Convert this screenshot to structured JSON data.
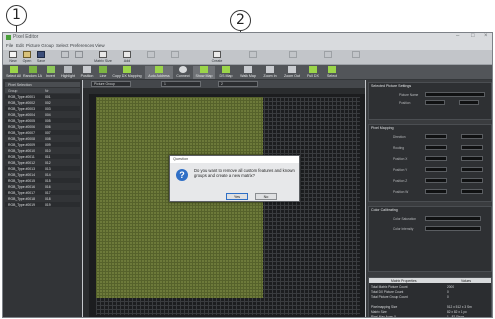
{
  "app": {
    "title": "Pixel Editor"
  },
  "window_controls": [
    "–",
    "□",
    "×"
  ],
  "menu": [
    "File",
    "Edit",
    "Picture Group",
    "Select",
    "Preferences",
    "View"
  ],
  "toolbar1": [
    "New",
    "Open",
    "Save",
    "",
    "",
    "Matrix Size",
    "Add",
    "",
    "Delete",
    "",
    "",
    "",
    "Create",
    "Fill",
    "",
    "",
    "",
    "",
    "",
    "",
    ""
  ],
  "toolbar2": [
    "Select All",
    "Random 1A",
    "Invert",
    "Highlight",
    "Position",
    "Line",
    "Copy DX Mapping",
    "Auto Address",
    "Connect",
    "Show Map",
    "DS Map",
    "Walk Map",
    "Zoom In",
    "Zoom Out",
    "Full DX",
    "Select"
  ],
  "left_panel": {
    "header": "Pixel Selection",
    "columns": [
      "Group",
      "Nr"
    ],
    "rows": [
      [
        "RGB_Type #0001",
        "001"
      ],
      [
        "RGB_Type #0002",
        "002"
      ],
      [
        "RGB_Type #0003",
        "003"
      ],
      [
        "RGB_Type #0004",
        "004"
      ],
      [
        "RGB_Type #0005",
        "005"
      ],
      [
        "RGB_Type #0006",
        "006"
      ],
      [
        "RGB_Type #0007",
        "007"
      ],
      [
        "RGB_Type #0008",
        "008"
      ],
      [
        "RGB_Type #0009",
        "009"
      ],
      [
        "RGB_Type #0010",
        "010"
      ],
      [
        "RGB_Type #0011",
        "011"
      ],
      [
        "RGB_Type #0012",
        "012"
      ],
      [
        "RGB_Type #0013",
        "013"
      ],
      [
        "RGB_Type #0014",
        "014"
      ],
      [
        "RGB_Type #0015",
        "015"
      ],
      [
        "RGB_Type #0016",
        "016"
      ],
      [
        "RGB_Type #0017",
        "017"
      ],
      [
        "RGB_Type #0018",
        "018"
      ],
      [
        "RGB_Type #0019",
        "019"
      ]
    ]
  },
  "canvas": {
    "selector_1": "Picture Group",
    "selector_2": "1",
    "selector_3": "2"
  },
  "right_panel": {
    "section1_title": "Selected Picture Settings",
    "section1_fields": [
      "Picture Name",
      "Position"
    ],
    "section2_title": "Pixel Mapping",
    "section2_fields": [
      "Direction",
      "Routing",
      "Position X",
      "Position Y",
      "Position Z",
      "Position W"
    ],
    "section3_title": "Color Calibrating",
    "section3_fields": [
      "Color Saturation",
      "Color Intensity"
    ],
    "table_headers": [
      "Matrix Properties",
      "Values"
    ],
    "table_rows": [
      [
        "Total Matrix Picture Count",
        "2000"
      ],
      [
        "Total DX Picture Count",
        "0"
      ],
      [
        "Total Picture Group Count",
        "0"
      ],
      [
        "",
        ""
      ],
      [
        "Pixelmapping Size",
        "512 x 512 x 3 Sm"
      ],
      [
        "Matrix Size",
        "82 x 82 x 1 pc"
      ],
      [
        "Pixel Max Array X",
        "1 - 82 Steps"
      ]
    ]
  },
  "dialog": {
    "title": "Question",
    "message": "Do you want to remove all custom features and known groups and create a new matrix?",
    "yes_label": "Yes",
    "no_label": "No"
  },
  "callouts": [
    "1",
    "2"
  ],
  "colors": {
    "accent_blue": "#2f6fc6",
    "pixel_green": "#6d7a3a",
    "dark_panel": "#323437"
  },
  "icons": {
    "new": "new-icon",
    "open": "folder-icon",
    "save": "floppy-icon",
    "matrix": "matrix-icon",
    "select_all": "grid-select-icon",
    "dialog": "question-icon"
  }
}
